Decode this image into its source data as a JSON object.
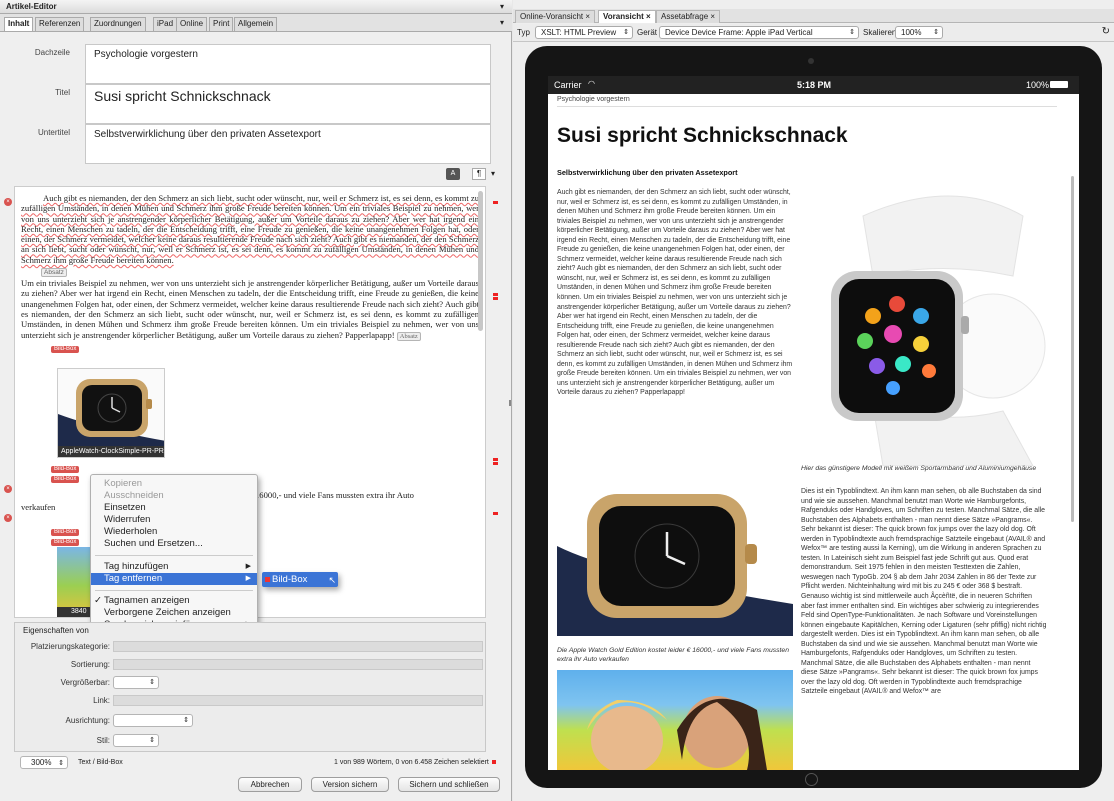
{
  "left": {
    "panel_title": "Artikel-Editor",
    "tabs": [
      "Inhalt",
      "Referenzen",
      "Zuordnungen",
      "iPad",
      "Online",
      "Print",
      "Allgemein"
    ],
    "fields": {
      "dachzeile_label": "Dachzeile",
      "dachzeile_value": "Psychologie vorgestern",
      "titel_label": "Titel",
      "titel_value": "Susi spricht Schnickschnack",
      "untertitel_label": "Untertitel",
      "untertitel_value": "Selbstverwirklichung über den privaten Assetexport"
    },
    "body": {
      "para1": "Auch gibt es niemanden, der den Schmerz an sich liebt, sucht oder wünscht, nur, weil er Schmerz ist, es sei denn, es kommt zu zufälligen Umständen, in denen Mühen und Schmerz ihm große Freude bereiten können. Um ein triviales Beispiel zu nehmen, wer von uns unterzieht sich je anstrengender körperlicher Betätigung, außer um Vorteile daraus zu ziehen? Aber wer hat irgend ein Recht, einen Menschen zu tadeln, der die Entscheidung trifft, eine Freude zu genießen, die keine unangenehmen Folgen hat, oder einen, der Schmerz vermeidet, welcher keine daraus resultierende Freude nach sich zieht? Auch gibt es niemanden, der den Schmerz an sich liebt, sucht oder wünscht, nur, weil er Schmerz ist, es sei denn, es kommt zu zufälligen Umständen, in denen Mühen und Schmerz ihm große Freude bereiten können.",
      "absatz": "Absatz",
      "para2": "Um ein triviales Beispiel zu nehmen, wer von uns unterzieht sich je anstrengender körperlicher Betätigung, außer um Vorteile daraus zu ziehen? Aber wer hat irgend ein Recht, einen Menschen zu tadeln, der die Entscheidung trifft, eine Freude zu genießen, die keine unangenehmen Folgen hat, oder einen, der Schmerz vermeidet, welcher keine daraus resultierende Freude nach sich zieht? Auch gibt es niemanden, der den Schmerz an sich liebt, sucht oder wünscht, nur, weil er Schmerz ist, es sei denn, es kommt zu zufälligen Umständen, in denen Mühen und Schmerz ihm große Freude bereiten können. Um ein triviales Beispiel zu nehmen, wer von uns unterzieht sich je anstrengender körperlicher Betätigung, außer um Vorteile daraus zu ziehen? Papperlapapp!",
      "bildbox": "Bild-Box",
      "image_caption": "AppleWatch-ClockSimple-PR-PRIN...",
      "caption_frag1": "16000,- und viele Fans mussten extra ihr Auto",
      "caption_frag2": "verkaufen",
      "image2_caption": "3840"
    },
    "context_menu": {
      "items": [
        "Kopieren",
        "Ausschneiden",
        "Einsetzen",
        "Widerrufen",
        "Wiederholen",
        "Suchen und Ersetzen...",
        "Tag hinzufügen",
        "Tag entfernen",
        "Tagnamen anzeigen",
        "Verborgene Zeichen anzeigen",
        "Sonderzeichen einfügen"
      ],
      "submenu_item": "Bild-Box"
    },
    "props": {
      "title": "Eigenschaften von",
      "labels": [
        "Platzierungskategorie:",
        "Sortierung:",
        "Vergrößerbar:",
        "Link:",
        "Ausrichtung:",
        "Stil:"
      ]
    },
    "footer": {
      "zoom": "300%",
      "path": "Text / Bild-Box",
      "count": "1 von 989 Wörtern, 0 von 6.458 Zeichen selektiert",
      "btn_cancel": "Abbrechen",
      "btn_save_version": "Version sichern",
      "btn_save_close": "Sichern und schließen"
    }
  },
  "right": {
    "tabs": [
      "Online-Voransicht",
      "Voransicht",
      "Assetabfrage"
    ],
    "typ_label": "Typ",
    "typ_value": "XSLT: HTML Preview",
    "geraet_label": "Gerät",
    "geraet_value": "Device Device Frame: Apple iPad Vertical",
    "skalieren_label": "Skalieren",
    "skalieren_value": "100%",
    "device": {
      "carrier": "Carrier",
      "time": "5:18 PM",
      "battery": "100%"
    },
    "article": {
      "dachzeile": "Psychologie vorgestern",
      "title": "Susi spricht Schnickschnack",
      "subtitle": "Selbstverwirklichung über den privaten Assetexport",
      "body": "Auch gibt es niemanden, der den Schmerz an sich liebt, sucht oder wünscht, nur, weil er Schmerz ist, es sei denn, es kommt zu zufälligen Umständen, in denen Mühen und Schmerz ihm große Freude bereiten können. Um ein triviales Beispiel zu nehmen, wer von uns unterzieht sich je anstrengender körperlicher Betätigung, außer um Vorteile daraus zu ziehen? Aber wer hat irgend ein Recht, einen Menschen zu tadeln, der die Entscheidung trifft, eine Freude zu genießen, die keine unangenehmen Folgen hat, oder einen, der Schmerz vermeidet, welcher keine daraus resultierende Freude nach sich zieht? Auch gibt es niemanden, der den Schmerz an sich liebt, sucht oder wünscht, nur, weil er Schmerz ist, es sei denn, es kommt zu zufälligen Umständen, in denen Mühen und Schmerz ihm große Freude bereiten können. Um ein triviales Beispiel zu nehmen, wer von uns unterzieht sich je anstrengender körperlicher Betätigung, außer um Vorteile daraus zu ziehen? Aber wer hat irgend ein Recht, einen Menschen zu tadeln, der die Entscheidung trifft, eine Freude zu genießen, die keine unangenehmen Folgen hat, oder einen, der Schmerz vermeidet, welcher keine daraus resultierende Freude nach sich zieht? Auch gibt es niemanden, der den Schmerz an sich liebt, sucht oder wünscht, nur, weil er Schmerz ist, es sei denn, es kommt zu zufälligen Umständen, in denen Mühen und Schmerz ihm große Freude bereiten können. Um ein triviales Beispiel zu nehmen, wer von uns unterzieht sich je anstrengender körperlicher Betätigung, außer um Vorteile daraus zu ziehen? Papperlapapp!",
      "caption_white": "Hier das günstigere Modell mit weißem Sportarmband und Aluminiumgehäuse",
      "caption_gold": "Die Apple Watch Gold Edition kostet leider € 16000,- und viele Fans mussten extra ihr Auto verkaufen",
      "body2": "Dies ist ein Typoblindtext. An ihm kann man sehen, ob alle Buchstaben da sind und wie sie aussehen. Manchmal benutzt man Worte wie Hamburgefonts, Rafgenduks oder Handgloves, um Schriften zu testen. Manchmal Sätze, die alle Buchstaben des Alphabets enthalten - man nennt diese Sätze »Pangrams«. Sehr bekannt ist dieser: The quick brown fox jumps over the lazy old dog. Oft werden in Typoblindtexte auch fremdsprachige Satzteile eingebaut (AVAIL® and Wefox™ are testing aussi la Kerning), um die Wirkung in anderen Sprachen zu testen. In Lateinisch sieht zum Beispiel fast jede Schrift gut aus. Quod erat demonstrandum. Seit 1975 fehlen in den meisten Testtexten die Zahlen, weswegen nach TypoGb. 204 § ab dem Jahr 2034 Zahlen in 86 der Texte zur Pflicht werden. Nichteinhaltung wird mit bis zu 245 € oder 368 $ bestraft. Genauso wichtig ist sind mittlerweile auch Âçcèñtë, die in neueren Schriften aber fast immer enthalten sind. Ein wichtiges aber schwierig zu integrierendes Feld sind OpenType-Funktionalitäten. Je nach Software und Voreinstellungen können eingebaute Kapitälchen, Kerning oder Ligaturen (sehr pfiffig) nicht richtig dargestellt werden. Dies ist ein Typoblindtext. An ihm kann man sehen, ob alle Buchstaben da sind und wie sie aussehen. Manchmal benutzt man Worte wie Hamburgefonts, Rafgenduks oder Handgloves, um Schriften zu testen. Manchmal Sätze, die alle Buchstaben des Alphabets enthalten - man nennt diese Sätze »Pangrams«. Sehr bekannt ist dieser: The quick brown fox jumps over the lazy old dog. Oft werden in Typoblindtexte auch fremdsprachige Satzteile eingebaut (AVAIL® and Wefox™ are"
    }
  }
}
